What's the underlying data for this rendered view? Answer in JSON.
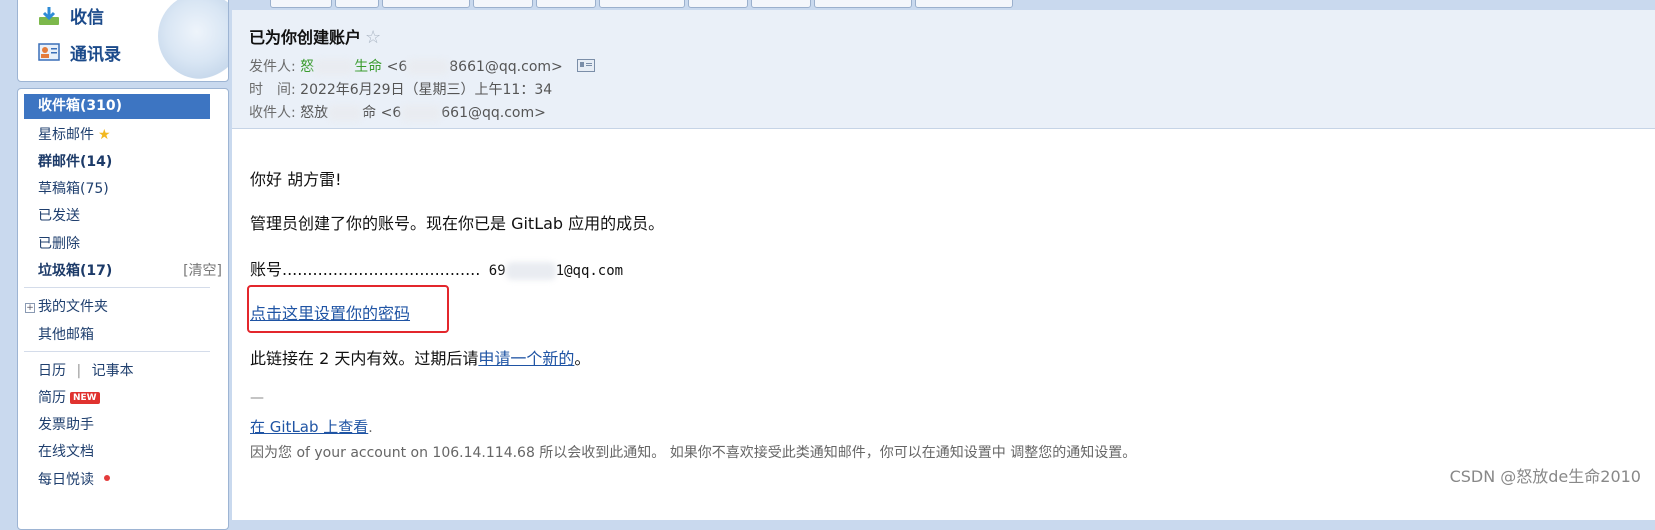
{
  "sidebar": {
    "quick": {
      "inbox_label": "收信",
      "contacts_label": "通讯录"
    },
    "items": {
      "inbox": "收件箱(310)",
      "starred": "星标邮件",
      "group": "群邮件(14)",
      "drafts": "草稿箱(75)",
      "sent": "已发送",
      "deleted": "已删除",
      "spam": "垃圾箱(17)",
      "spam_clear": "[清空]",
      "my_folders": "我的文件夹",
      "other_mailbox": "其他邮箱",
      "calendar": "日历",
      "calendar_sep": "|",
      "notepad": "记事本",
      "resume": "简历",
      "resume_badge": "NEW",
      "invoice": "发票助手",
      "docs": "在线文档",
      "daily": "每日悦读"
    }
  },
  "email": {
    "subject": "已为你创建账户",
    "star_icon": "☆",
    "from_label": "发件人:",
    "from_name_a": "怒",
    "from_name_b": "生命",
    "from_addr_a": "<6",
    "from_addr_b": "8661@qq.com>",
    "time_label": "时　间:",
    "time_value": "2022年6月29日（星期三）上午11：34",
    "to_label": "收件人:",
    "to_name_a": "怒放",
    "to_name_b": "命",
    "to_addr_a": "<6",
    "to_addr_b": "661@qq.com>"
  },
  "body": {
    "greeting": "你好 胡方雷!",
    "line1": "管理员创建了你的账号。现在你已是 GitLab 应用的成员。",
    "account_label": "账号.......................................",
    "account_a": " 69",
    "account_b": "1@qq.com",
    "set_password_link": "点击这里设置你的密码",
    "validity_text": "此链接在 2 天内有效。过期后请",
    "request_new_link": "申请一个新的",
    "validity_end": "。",
    "dash": "—",
    "view_on_gitlab": "在 GitLab 上查看",
    "view_dot": ".",
    "notice": "因为您 of your account on 106.14.114.68 所以会收到此通知。 如果你不喜欢接受此类通知邮件，你可以在通知设置中 调整您的通知设置。"
  },
  "watermark": "CSDN @怒放de生命2010",
  "colors": {
    "accent": "#3d75c2",
    "link": "#1f54a4",
    "highlight_box": "#e3262c"
  }
}
